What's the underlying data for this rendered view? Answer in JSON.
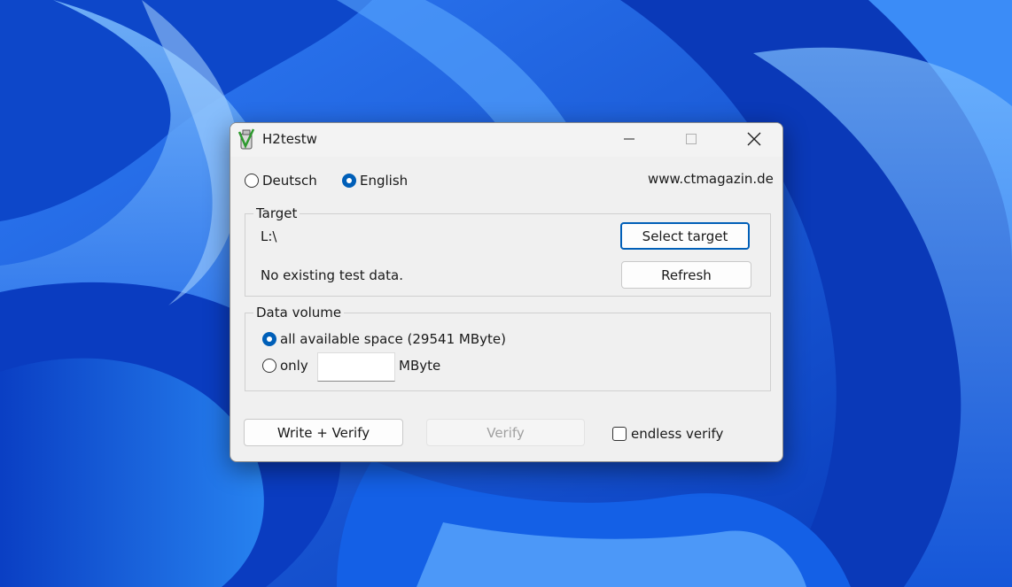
{
  "window": {
    "title": "H2testw",
    "icon": "h2testw-app-icon"
  },
  "language": {
    "options": [
      {
        "label": "Deutsch",
        "selected": false
      },
      {
        "label": "English",
        "selected": true
      }
    ],
    "website": "www.ctmagazin.de"
  },
  "target": {
    "group_label": "Target",
    "path": "L:\\",
    "status": "No existing test data.",
    "select_button": "Select target",
    "refresh_button": "Refresh"
  },
  "data_volume": {
    "group_label": "Data volume",
    "all_space_label": "all available space (29541 MByte)",
    "all_space_selected": true,
    "only_label": "only",
    "only_selected": false,
    "only_value": "",
    "unit": "MByte"
  },
  "actions": {
    "write_verify": "Write + Verify",
    "verify": "Verify",
    "endless_verify_label": "endless verify",
    "endless_verify_checked": false
  },
  "colors": {
    "accent": "#005fb8",
    "wallpaper": "#0b4fd8"
  }
}
